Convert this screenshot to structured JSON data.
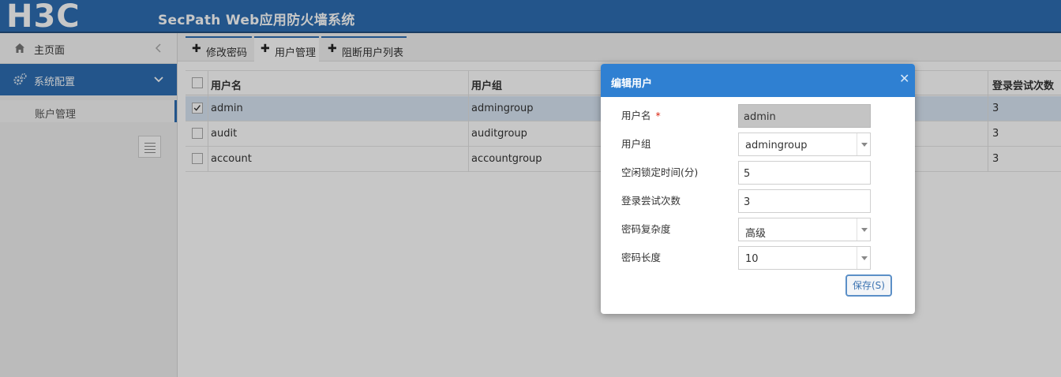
{
  "header": {
    "logo_text": "H3C",
    "title": "SecPath Web应用防火墙系统"
  },
  "sidebar": {
    "home": {
      "label": "主页面",
      "icon": "home-icon"
    },
    "system": {
      "label": "系统配置",
      "icon": "gears-icon"
    },
    "sub_items": [
      {
        "label": "账户管理"
      }
    ],
    "menu_toggle_icon": "menu-icon"
  },
  "tabs": [
    {
      "label": "修改密码",
      "active": false
    },
    {
      "label": "用户管理",
      "active": true
    },
    {
      "label": "阻断用户列表",
      "active": false
    }
  ],
  "table": {
    "columns": [
      "用户名",
      "用户组",
      "登录尝试次数"
    ],
    "rows": [
      {
        "username": "admin",
        "group": "admingroup",
        "attempts": "3",
        "checked": true
      },
      {
        "username": "audit",
        "group": "auditgroup",
        "attempts": "3",
        "checked": false
      },
      {
        "username": "account",
        "group": "accountgroup",
        "attempts": "3",
        "checked": false
      }
    ]
  },
  "modal": {
    "title": "编辑用户",
    "close_icon": "close-icon",
    "fields": {
      "username": {
        "label": "用户名",
        "value": "admin",
        "required_mark": "*"
      },
      "group": {
        "label": "用户组",
        "value": "admingroup"
      },
      "idle_lock": {
        "label": "空闲锁定时间(分)",
        "value": "5"
      },
      "login_attempts": {
        "label": "登录尝试次数",
        "value": "3"
      },
      "complexity": {
        "label": "密码复杂度",
        "value": "高级"
      },
      "length": {
        "label": "密码长度",
        "value": "10"
      }
    },
    "save_label": "保存(S)"
  },
  "colors": {
    "header_bg": "#2d6eb2",
    "modal_header_bg": "#2f80d2",
    "selected_row_bg": "#d9e6f4",
    "required_mark": "#d9230f"
  }
}
